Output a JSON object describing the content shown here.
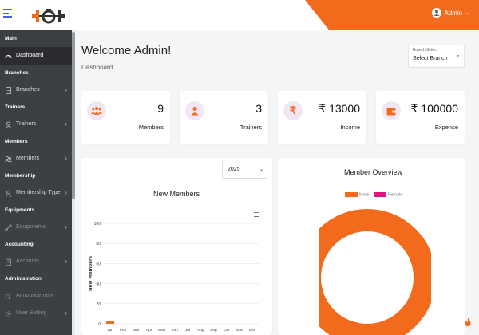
{
  "colors": {
    "accent": "#f26b1d",
    "sidebar": "#3c3f44",
    "male": "#f26b1d",
    "female": "#e0147a"
  },
  "user": {
    "name": "Admin"
  },
  "sidebar": {
    "sections": {
      "main": "Main",
      "branches": "Branches",
      "trainers": "Trainers",
      "members": "Members",
      "membership": "Membership",
      "equipments": "Equipments",
      "accounting": "Accounting",
      "administration": "Administration"
    },
    "items": {
      "dashboard": "Dashboard",
      "branches": "Branches",
      "trainers": "Trainers",
      "members": "Members",
      "membership_type": "Membership Type",
      "equipments": "Equipments",
      "accounts": "Accounts",
      "announcement": "Announcement",
      "user_setting": "User Setting"
    }
  },
  "page": {
    "title": "Welcome Admin!",
    "breadcrumb": "Dashboard"
  },
  "branch_select": {
    "label": "Branch Select",
    "value": "Select Branch"
  },
  "stats": [
    {
      "value": "9",
      "label": "Members",
      "icon": "group-icon"
    },
    {
      "value": "3",
      "label": "Trainers",
      "icon": "person-icon"
    },
    {
      "value": "₹ 13000",
      "label": "Income",
      "icon": "rupee-icon"
    },
    {
      "value": "₹ 100000",
      "label": "Expense",
      "icon": "wallet-icon"
    }
  ],
  "year_select": {
    "value": "2025"
  },
  "chart_data": [
    {
      "type": "bar",
      "title": "New Members",
      "ylabel": "New Members",
      "xlabel": "",
      "categories": [
        "Jan",
        "Feb",
        "Mar",
        "Apr",
        "May",
        "Jun",
        "Jul",
        "Aug",
        "Sep",
        "Oct",
        "Nov",
        "Dec"
      ],
      "values": [
        3,
        0,
        0,
        0,
        0,
        0,
        0,
        0,
        0,
        0,
        0,
        0
      ],
      "yticks": [
        "0",
        "20",
        "40",
        "60",
        "80",
        "100"
      ],
      "ylim": [
        0,
        100
      ],
      "grid": true
    },
    {
      "type": "pie",
      "title": "Member Overview",
      "categories": [
        "Male",
        "Female"
      ],
      "values": [
        9,
        0
      ],
      "legend": "top"
    }
  ]
}
